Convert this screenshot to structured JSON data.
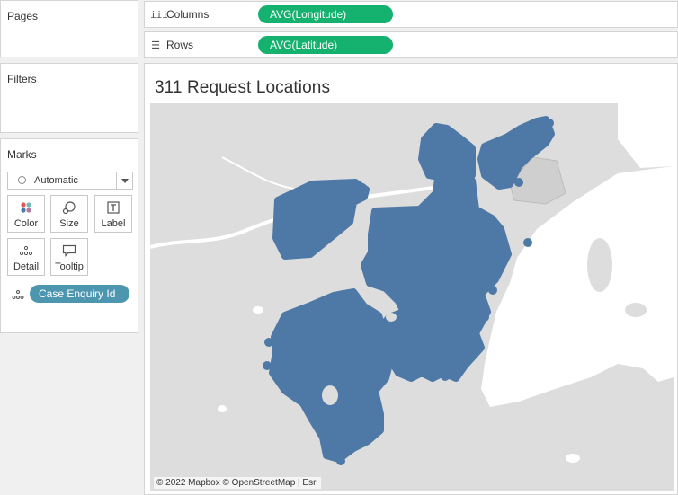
{
  "pages": {
    "title": "Pages"
  },
  "filters": {
    "title": "Filters"
  },
  "marks": {
    "title": "Marks",
    "mark_type": "Automatic",
    "buttons": {
      "color": "Color",
      "size": "Size",
      "label": "Label",
      "detail": "Detail",
      "tooltip": "Tooltip"
    },
    "detail_field": "Case Enquiry Id"
  },
  "shelves": {
    "columns": {
      "label": "Columns",
      "pill": "AVG(Longitude)"
    },
    "rows": {
      "label": "Rows",
      "pill": "AVG(Latitude)"
    }
  },
  "sheet": {
    "title": "311 Request Locations",
    "attribution": "© 2022 Mapbox © OpenStreetMap | Esri"
  },
  "colors": {
    "mark_blue": "#4e79a7",
    "pill_green": "#14b16f",
    "detail_pill": "#4d96b0",
    "map_land": "#dddddd",
    "map_water": "#ffffff"
  }
}
